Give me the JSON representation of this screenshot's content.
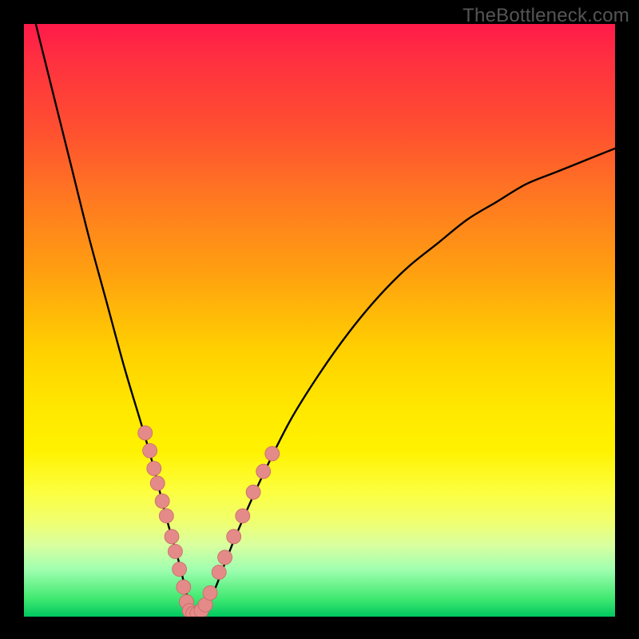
{
  "watermark": "TheBottleneck.com",
  "colors": {
    "frame": "#000000",
    "dot_fill": "#e48a88",
    "dot_stroke": "#c96a68",
    "curve": "#000000"
  },
  "chart_data": {
    "type": "line",
    "title": "",
    "xlabel": "",
    "ylabel": "",
    "xlim": [
      0,
      100
    ],
    "ylim": [
      0,
      100
    ],
    "grid": false,
    "legend": false,
    "notes": "V-shaped bottleneck curve on rainbow gradient; minimum near x≈28 at y≈0. No axis ticks or labels visible.",
    "series": [
      {
        "name": "curve",
        "x": [
          2,
          5,
          8,
          11,
          14,
          17,
          20,
          22,
          24,
          26,
          27,
          28,
          29,
          30,
          32,
          34,
          36,
          40,
          45,
          50,
          55,
          60,
          65,
          70,
          75,
          80,
          85,
          90,
          95,
          100
        ],
        "y": [
          100,
          88,
          76,
          64,
          53,
          42,
          32,
          25,
          17,
          10,
          6,
          2,
          0,
          1,
          4,
          9,
          14,
          23,
          33,
          41,
          48,
          54,
          59,
          63,
          67,
          70,
          73,
          75,
          77,
          79
        ]
      }
    ],
    "scatter_points": {
      "name": "highlight-dots",
      "points": [
        {
          "x": 20.5,
          "y": 31
        },
        {
          "x": 21.3,
          "y": 28
        },
        {
          "x": 22.0,
          "y": 25
        },
        {
          "x": 22.6,
          "y": 22.5
        },
        {
          "x": 23.4,
          "y": 19.5
        },
        {
          "x": 24.1,
          "y": 17
        },
        {
          "x": 25.0,
          "y": 13.5
        },
        {
          "x": 25.6,
          "y": 11
        },
        {
          "x": 26.3,
          "y": 8
        },
        {
          "x": 27.0,
          "y": 5
        },
        {
          "x": 27.5,
          "y": 2.5
        },
        {
          "x": 28.0,
          "y": 1
        },
        {
          "x": 28.6,
          "y": 0.5
        },
        {
          "x": 29.3,
          "y": 0.5
        },
        {
          "x": 30.0,
          "y": 1
        },
        {
          "x": 30.7,
          "y": 2
        },
        {
          "x": 31.5,
          "y": 4
        },
        {
          "x": 33.0,
          "y": 7.5
        },
        {
          "x": 34.0,
          "y": 10
        },
        {
          "x": 35.5,
          "y": 13.5
        },
        {
          "x": 37.0,
          "y": 17
        },
        {
          "x": 38.8,
          "y": 21
        },
        {
          "x": 40.5,
          "y": 24.5
        },
        {
          "x": 42.0,
          "y": 27.5
        }
      ]
    }
  }
}
